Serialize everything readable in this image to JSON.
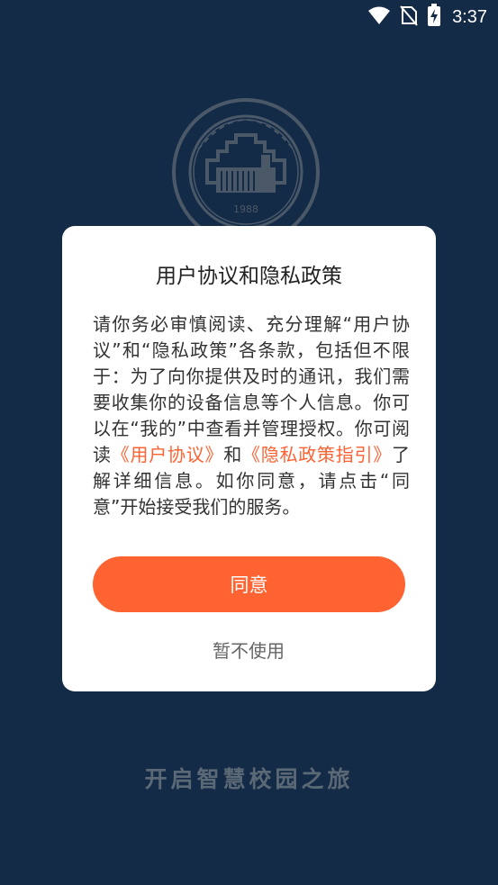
{
  "status_bar": {
    "time": "3:37",
    "icons": [
      "wifi-icon",
      "no-sim-icon",
      "battery-charging-icon"
    ]
  },
  "splash": {
    "logo_year": "1988",
    "slogan": "开启智慧校园之旅"
  },
  "dialog": {
    "title": "用户协议和隐私政策",
    "body_prefix": "请你务必审慎阅读、充分理解“用户协议”和“隐私政策”各条款，包括但不限于：为了向你提供及时的通讯，我们需要收集你的设备信息等个人信息。你可以在“我的”中查看并管理授权。你可阅读",
    "link_user_agreement": "《用户协议》",
    "body_and": "和",
    "link_privacy_guide": "《隐私政策指引》",
    "body_suffix": "了解详细信息。如你同意，请点击“同意”开始接受我们的服务。",
    "agree_label": "同意",
    "decline_label": "暂不使用"
  },
  "colors": {
    "background": "#142b47",
    "accent": "#ff6332",
    "dialog_bg": "#ffffff"
  }
}
